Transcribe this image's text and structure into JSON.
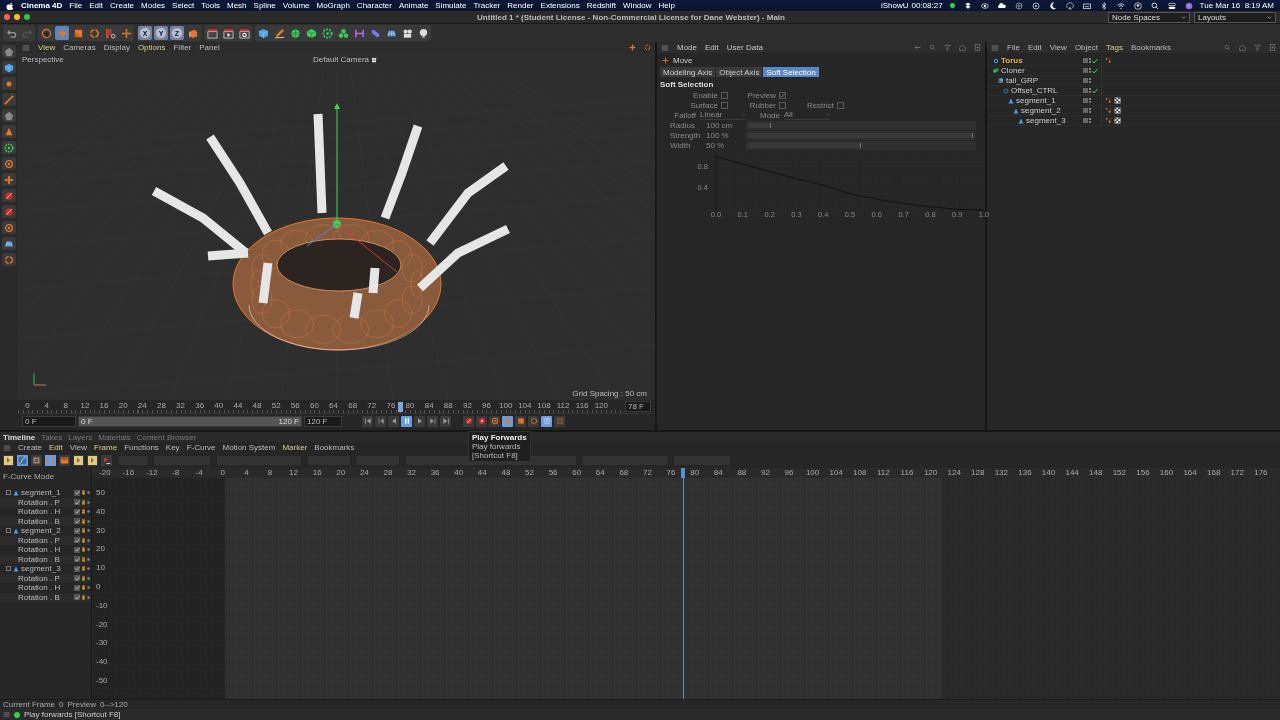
{
  "menu_bar": {
    "app": "Cinema 4D",
    "items": [
      "File",
      "Edit",
      "Create",
      "Modes",
      "Select",
      "Tools",
      "Mesh",
      "Spline",
      "Volume",
      "MoGraph",
      "Character",
      "Animate",
      "Simulate",
      "Tracker",
      "Render",
      "Extensions",
      "Redshift",
      "Window",
      "Help"
    ],
    "recorder_name": "iShowU",
    "recorder_time": "00:08:27",
    "clock": "Tue Mar 16  8:19 AM"
  },
  "window": {
    "title": "Untitled 1 * (Student License - Non-Commercial License for Dane Webster) - Main",
    "node_spaces": "Node Spaces",
    "layouts": "Layouts"
  },
  "toolbar": {
    "tools": [
      {
        "kind": "select",
        "selected": false
      },
      {
        "kind": "move",
        "selected": true
      },
      {
        "kind": "scale",
        "selected": false
      },
      {
        "kind": "rotate",
        "selected": false
      }
    ],
    "axes": [
      {
        "label": "X",
        "selected": true
      },
      {
        "label": "Y",
        "selected": true
      },
      {
        "label": "Z",
        "selected": true
      }
    ]
  },
  "viewport": {
    "menu": [
      {
        "label": "View",
        "highlighted": true
      },
      {
        "label": "Cameras",
        "highlighted": false
      },
      {
        "label": "Display",
        "highlighted": false
      },
      {
        "label": "Options",
        "highlighted": true
      },
      {
        "label": "Filter",
        "highlighted": false
      },
      {
        "label": "Panel",
        "highlighted": false
      }
    ],
    "view_name": "Perspective",
    "camera": "Default Camera",
    "grid_spacing": "Grid Spacing : 50 cm"
  },
  "time_bar": {
    "ticks": [
      "0",
      "4",
      "8",
      "12",
      "16",
      "20",
      "24",
      "28",
      "32",
      "36",
      "40",
      "44",
      "48",
      "52",
      "56",
      "60",
      "64",
      "68",
      "72",
      "76",
      "80",
      "84",
      "88",
      "92",
      "96",
      "100",
      "104",
      "108",
      "112",
      "116",
      "120"
    ],
    "playhead": {
      "level": 0.65
    },
    "current_frame": "78 F",
    "start": "0 F",
    "range": {
      "level": 1
    },
    "range_start": "0 F",
    "range_end": "120 F",
    "end": "120 F",
    "transport": [
      {
        "kind": "first",
        "selected": false
      },
      {
        "kind": "prev-key",
        "selected": false
      },
      {
        "kind": "prev-frame",
        "selected": false
      },
      {
        "kind": "play",
        "selected": true
      },
      {
        "kind": "next-frame",
        "selected": false
      },
      {
        "kind": "next-key",
        "selected": false
      },
      {
        "kind": "last",
        "selected": false
      }
    ],
    "keying": [
      {
        "kind": "record",
        "selected": false
      },
      {
        "kind": "autokey",
        "selected": false
      },
      {
        "kind": "keyset",
        "selected": false
      },
      {
        "kind": "move",
        "selected": true
      },
      {
        "kind": "scale",
        "selected": false
      },
      {
        "kind": "rotate",
        "selected": false
      },
      {
        "kind": "param",
        "selected": true
      },
      {
        "kind": "points",
        "selected": false
      }
    ],
    "tooltip": {
      "title": "Play Forwards",
      "text": "Play forwards",
      "shortcut": "[Shortcut F8]"
    }
  },
  "attributes": {
    "menu": [
      "Mode",
      "Edit",
      "User Data"
    ],
    "tool": "Move",
    "tabs": [
      {
        "label": "Modeling Axis",
        "selected": false
      },
      {
        "label": "Object Axis",
        "selected": false
      },
      {
        "label": "Soft Selection",
        "selected": true
      }
    ],
    "section": "Soft Selection",
    "disabled": true,
    "check_rows": [
      [
        {
          "label": "Enable",
          "checked": false
        },
        {
          "label": "Preview",
          "checked": true
        }
      ],
      [
        {
          "label": "Surface",
          "checked": false
        },
        {
          "label": "Rubber",
          "checked": false
        },
        {
          "label": "Restrict",
          "checked": false
        }
      ]
    ],
    "dropdowns": [
      {
        "label": "Falloff",
        "value": "Linear"
      },
      {
        "label": "Mode",
        "value": "All"
      }
    ],
    "sliders": [
      {
        "label": "Radius",
        "value": "100 cm",
        "level": 0.1
      },
      {
        "label": "Strength",
        "value": "100 %",
        "level": 1
      },
      {
        "label": "Width",
        "value": "50 %",
        "level": 0.5
      }
    ],
    "chart_data": {
      "type": "line",
      "x": [
        0,
        0.1,
        0.2,
        0.3,
        0.4,
        0.5,
        0.6,
        0.7,
        0.8,
        0.9,
        1
      ],
      "series": [
        {
          "color": "#111111",
          "values": [
            0.99,
            0.85,
            0.71,
            0.58,
            0.46,
            0.3,
            0.2,
            0.12,
            0.06,
            0.01,
            0
          ]
        }
      ],
      "xlim": [
        0,
        1
      ],
      "ylim": [
        0,
        1
      ],
      "xticks": [
        {
          "value": 0,
          "label": "0.0"
        },
        0.1,
        0.2,
        0.3,
        0.4,
        0.5,
        0.6,
        0.7,
        0.8,
        0.9,
        {
          "value": 1,
          "label": "1.0"
        }
      ],
      "yticks": [
        0.4,
        0.8
      ]
    }
  },
  "objects": {
    "menu": [
      {
        "label": "File",
        "highlighted": false
      },
      {
        "label": "Edit",
        "highlighted": false
      },
      {
        "label": "View",
        "highlighted": false
      },
      {
        "label": "Object",
        "highlighted": false
      },
      {
        "label": "Tags",
        "highlighted": true
      },
      {
        "label": "Bookmarks",
        "highlighted": false
      }
    ],
    "items": [
      {
        "name": "Torus",
        "kind": "torus",
        "selected": true,
        "enabled": true,
        "tags": [
          {
            "kind": "dots"
          }
        ]
      },
      {
        "name": "Cloner",
        "kind": "cloner",
        "selected": false,
        "enabled": true,
        "children": [
          {
            "name": "tail_GRP",
            "kind": "null",
            "selected": false,
            "enabled": false,
            "children": [
              {
                "name": "Offset_CTRL",
                "kind": "circle",
                "selected": false,
                "enabled": true,
                "children": [
                  {
                    "name": "segment_1",
                    "kind": "joint",
                    "selected": false,
                    "enabled": false,
                    "tags": [
                      {
                        "kind": "dots"
                      },
                      {
                        "kind": "checker"
                      }
                    ],
                    "children": [
                      {
                        "name": "segment_2",
                        "kind": "joint",
                        "selected": false,
                        "enabled": false,
                        "tags": [
                          {
                            "kind": "dots"
                          },
                          {
                            "kind": "checker"
                          }
                        ],
                        "children": [
                          {
                            "name": "segment_3",
                            "kind": "joint",
                            "selected": false,
                            "enabled": false,
                            "tags": [
                              {
                                "kind": "dots"
                              },
                              {
                                "kind": "checker"
                              }
                            ]
                          }
                        ]
                      }
                    ]
                  }
                ]
              }
            ]
          }
        ]
      }
    ]
  },
  "timeline": {
    "tabs": [
      {
        "label": "Timeline",
        "selected": true
      },
      {
        "label": "Takes",
        "selected": false
      },
      {
        "label": "Layers",
        "selected": false
      },
      {
        "label": "Materials",
        "selected": false
      },
      {
        "label": "Content Browser",
        "selected": false
      }
    ],
    "menu": [
      {
        "label": "Create",
        "highlighted": false
      },
      {
        "label": "Edit",
        "highlighted": true
      },
      {
        "label": "View",
        "highlighted": false
      },
      {
        "label": "Frame",
        "highlighted": true
      },
      {
        "label": "Functions",
        "highlighted": false
      },
      {
        "label": "Key",
        "highlighted": false
      },
      {
        "label": "F-Curve",
        "highlighted": false
      },
      {
        "label": "Motion System",
        "highlighted": false
      },
      {
        "label": "Marker",
        "highlighted": true
      },
      {
        "label": "Bookmarks",
        "highlighted": false
      }
    ],
    "tools": [
      {
        "kind": "keyadd",
        "selected": false
      },
      {
        "kind": "curve",
        "selected": true
      },
      {
        "kind": "dope",
        "selected": false
      },
      {
        "kind": "brackets",
        "selected": true
      },
      {
        "kind": "film",
        "selected": false
      },
      {
        "kind": "keyadd",
        "selected": false
      },
      {
        "kind": "keyadd",
        "selected": false
      },
      {
        "kind": "keydel",
        "selected": false
      }
    ],
    "mode": "F-Curve Mode",
    "tracks": [
      {
        "name": "segment_1",
        "checked": true,
        "children": [
          {
            "name": "Rotation . P",
            "checked": true
          },
          {
            "name": "Rotation . H",
            "checked": true
          },
          {
            "name": "Rotation . B",
            "checked": true
          }
        ]
      },
      {
        "name": "segment_2",
        "checked": true,
        "children": [
          {
            "name": "Rotation . P",
            "checked": true
          },
          {
            "name": "Rotation . H",
            "checked": true
          },
          {
            "name": "Rotation . B",
            "checked": true
          }
        ]
      },
      {
        "name": "segment_3",
        "checked": true,
        "children": [
          {
            "name": "Rotation . P",
            "checked": true
          },
          {
            "name": "Rotation . H",
            "checked": true
          },
          {
            "name": "Rotation . B",
            "checked": true
          }
        ]
      }
    ],
    "ticks": [
      "-20",
      "-16",
      "-12",
      "-8",
      "-4",
      "0",
      "4",
      "8",
      "12",
      "16",
      "20",
      "24",
      "28",
      "32",
      "36",
      "40",
      "44",
      "48",
      "52",
      "56",
      "60",
      "64",
      "68",
      "72",
      "76",
      "80",
      "84",
      "88",
      "92",
      "96",
      "100",
      "104",
      "108",
      "112",
      "116",
      "120",
      "124",
      "128",
      "132",
      "136",
      "140",
      "144",
      "148",
      "152",
      "156",
      "160",
      "164",
      "168",
      "172",
      "176"
    ],
    "playhead": {
      "level": 0.5
    },
    "values": [
      "50",
      "40",
      "30",
      "20",
      "10",
      "0",
      "-10",
      "-20",
      "-30",
      "-40",
      "-50"
    ],
    "frame_label": "Current Frame",
    "frame": "0",
    "preview_label": "Preview",
    "preview": "0-->120"
  },
  "status_bar": "Play forwards [Shortcut F8]"
}
